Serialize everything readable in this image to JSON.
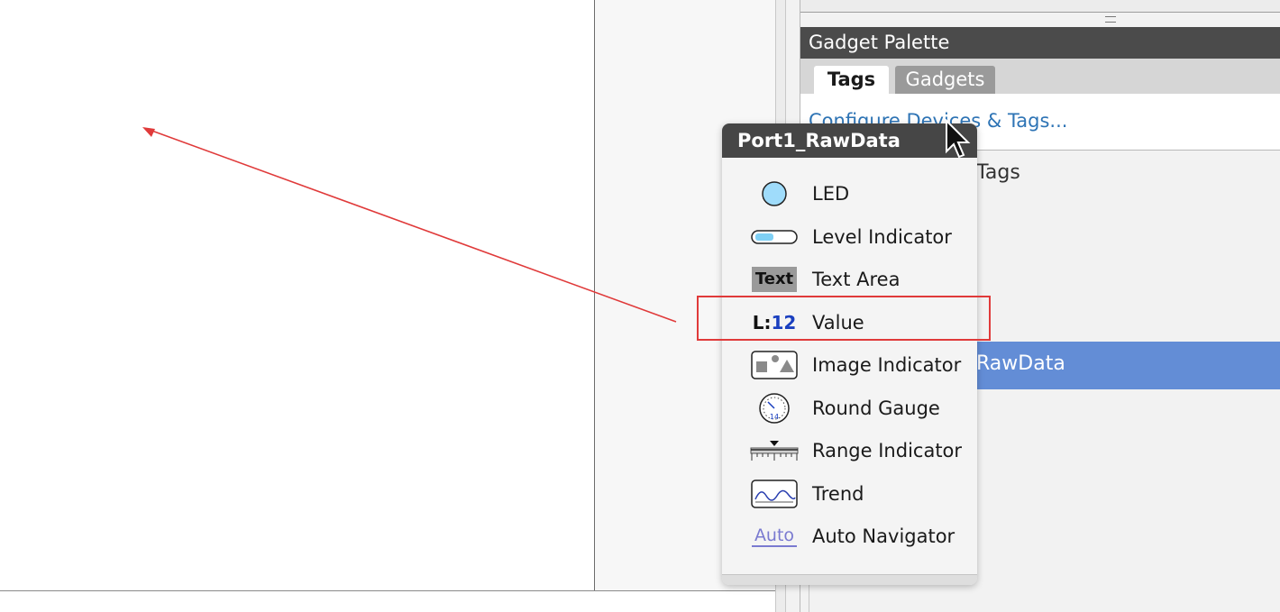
{
  "gadget_palette": {
    "title": "Gadget Palette",
    "tabs": [
      {
        "label": "Tags",
        "active": true
      },
      {
        "label": "Gadgets",
        "active": false
      }
    ],
    "configure_link": "Configure Devices & Tags...",
    "tag_group_label_partial": "l Tags",
    "selected_tag_partial": "RawData"
  },
  "popup": {
    "title": "Port1_RawData",
    "items": [
      {
        "label": "LED",
        "icon": "led-icon"
      },
      {
        "label": "Level Indicator",
        "icon": "level-indicator-icon"
      },
      {
        "label": "Text Area",
        "icon": "text-area-icon",
        "icon_text": "Text"
      },
      {
        "label": "Value",
        "icon": "value-icon",
        "icon_text_a": "L:",
        "icon_text_b": "12",
        "highlighted": true
      },
      {
        "label": "Image Indicator",
        "icon": "image-indicator-icon"
      },
      {
        "label": "Round Gauge",
        "icon": "round-gauge-icon",
        "icon_text": "14"
      },
      {
        "label": "Range Indicator",
        "icon": "range-indicator-icon"
      },
      {
        "label": "Trend",
        "icon": "trend-icon"
      },
      {
        "label": "Auto Navigator",
        "icon": "auto-navigator-icon",
        "icon_text": "Auto"
      }
    ]
  },
  "colors": {
    "header_bg": "#464646",
    "selection": "#638dd6",
    "link": "#2e74b5",
    "annotation": "#e03a3a"
  }
}
